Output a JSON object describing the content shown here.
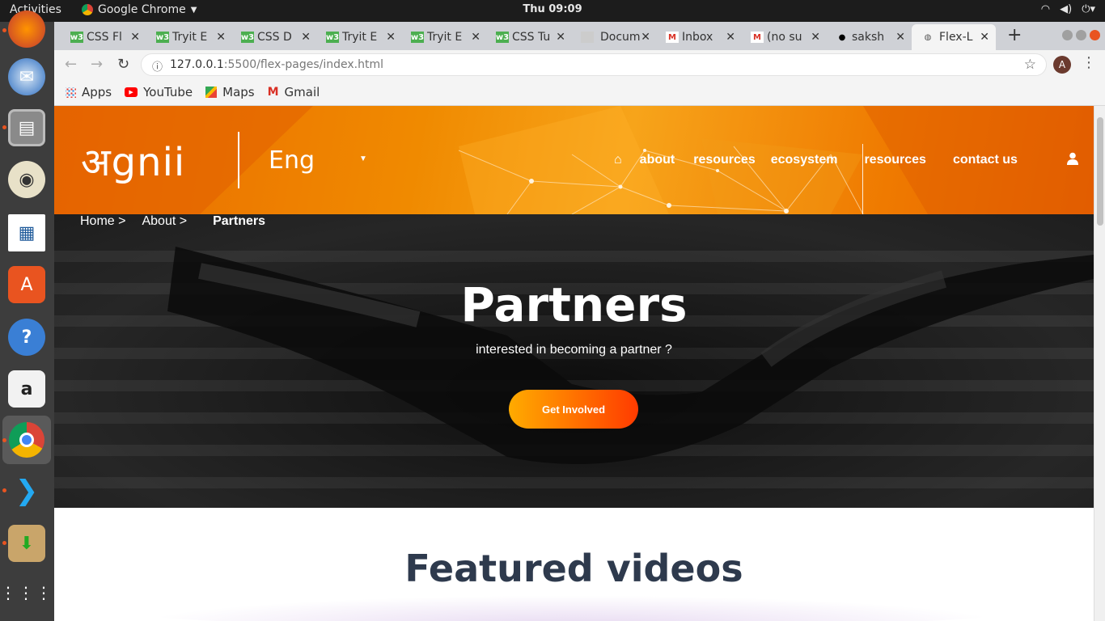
{
  "system": {
    "activities": "Activities",
    "app_name": "Google Chrome",
    "clock": "Thu 09:09"
  },
  "tabs": [
    {
      "label": "CSS Fl",
      "icon": "codepen-icon"
    },
    {
      "label": "Tryit E",
      "icon": "w3schools-icon"
    },
    {
      "label": "CSS D",
      "icon": "w3schools-icon"
    },
    {
      "label": "Tryit E",
      "icon": "w3schools-icon"
    },
    {
      "label": "Tryit E",
      "icon": "w3schools-icon"
    },
    {
      "label": "CSS Tu",
      "icon": "w3schools-icon"
    },
    {
      "label": "Docum",
      "icon": "doc-icon"
    },
    {
      "label": "Inbox",
      "icon": "gmail-icon"
    },
    {
      "label": "(no su",
      "icon": "gmail-icon"
    },
    {
      "label": "saksh",
      "icon": "github-icon"
    },
    {
      "label": "Flex-L",
      "icon": "globe-icon",
      "selected": true
    }
  ],
  "omnibox": {
    "url_host": "127.0.0.1",
    "url_rest": ":5500/flex-pages/index.html"
  },
  "profile_initial": "A",
  "bookmarks": [
    {
      "label": "Apps",
      "icon": "apps-grid-icon"
    },
    {
      "label": "YouTube",
      "icon": "youtube-icon"
    },
    {
      "label": "Maps",
      "icon": "maps-icon"
    },
    {
      "label": "Gmail",
      "icon": "gmail-icon"
    }
  ],
  "site": {
    "logo": "अgnii",
    "language": "Eng",
    "nav": [
      "about",
      "resources",
      "ecosystem",
      "resources",
      "contact us"
    ],
    "breadcrumbs": {
      "home": "Home >",
      "about": "About >",
      "current": "Partners"
    },
    "hero": {
      "title": "Partners",
      "subtitle": "interested in becoming a partner ?",
      "cta": "Get Involved"
    },
    "featured_title": "Featured videos"
  },
  "colors": {
    "header_orange": "#f08a00",
    "cta_start": "#ffab00",
    "cta_end": "#ff3b00",
    "featured_title": "#2e3a4d"
  }
}
